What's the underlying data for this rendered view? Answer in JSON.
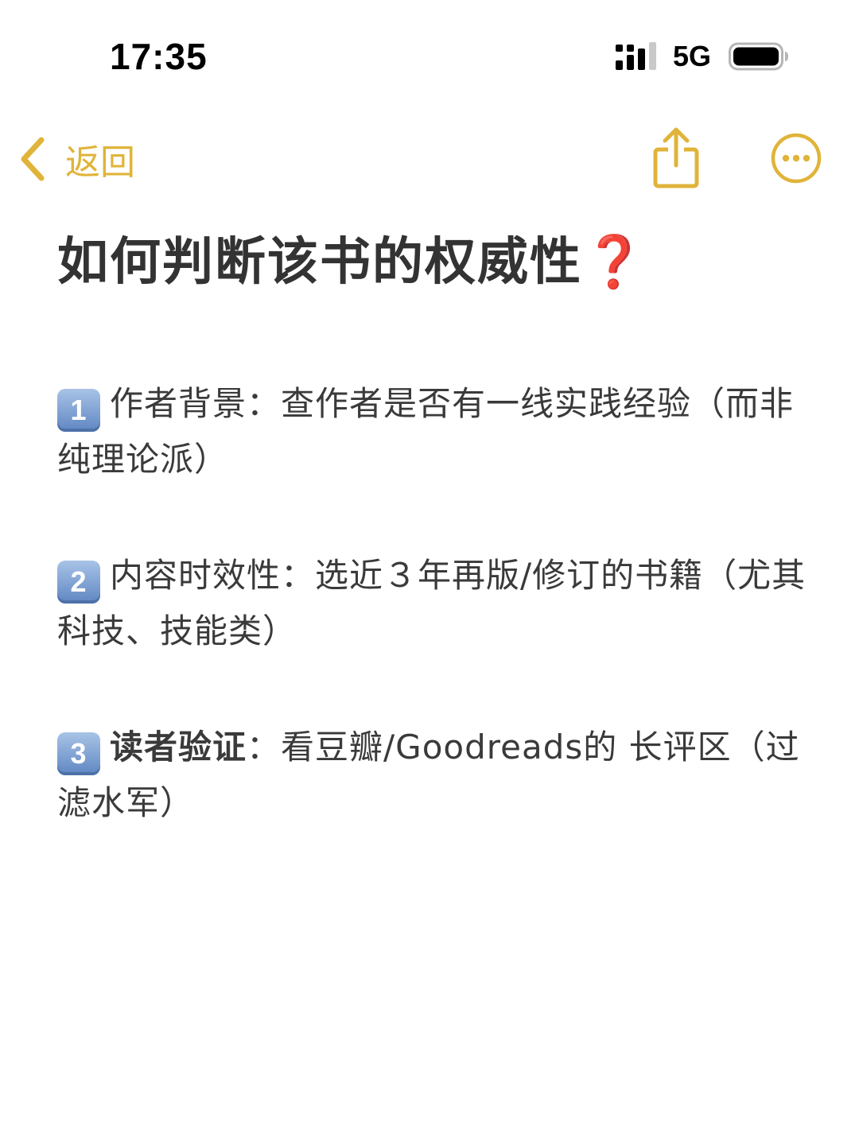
{
  "status_bar": {
    "time": "17:35",
    "network": "5G",
    "icons": [
      "signal-bars-icon",
      "battery-icon"
    ]
  },
  "nav": {
    "back_label": "返回",
    "icons": [
      "chevron-left-icon",
      "share-icon",
      "more-options-icon"
    ]
  },
  "colors": {
    "accent": "#e0b43a",
    "title_text": "#333333",
    "body_text": "#3a3a3a",
    "question_mark": "#d62b24",
    "keycap": "#6f93cc"
  },
  "note": {
    "title": "如何判断该书的权威性",
    "title_mark": "❓",
    "items": [
      {
        "number": "1",
        "label": "作者背景",
        "label_bold": false,
        "separator": "：",
        "text": "查作者是否有一线实践经验（而非纯理论派）"
      },
      {
        "number": "2",
        "label": "内容时效性",
        "label_bold": false,
        "separator": "：",
        "text": "选近３年再版/修订的书籍（尤其科技、技能类）"
      },
      {
        "number": "3",
        "label": "读者验证",
        "label_bold": true,
        "separator": "：",
        "text": "看豆瓣/Goodreads的 长评区（过滤水军）"
      }
    ]
  }
}
